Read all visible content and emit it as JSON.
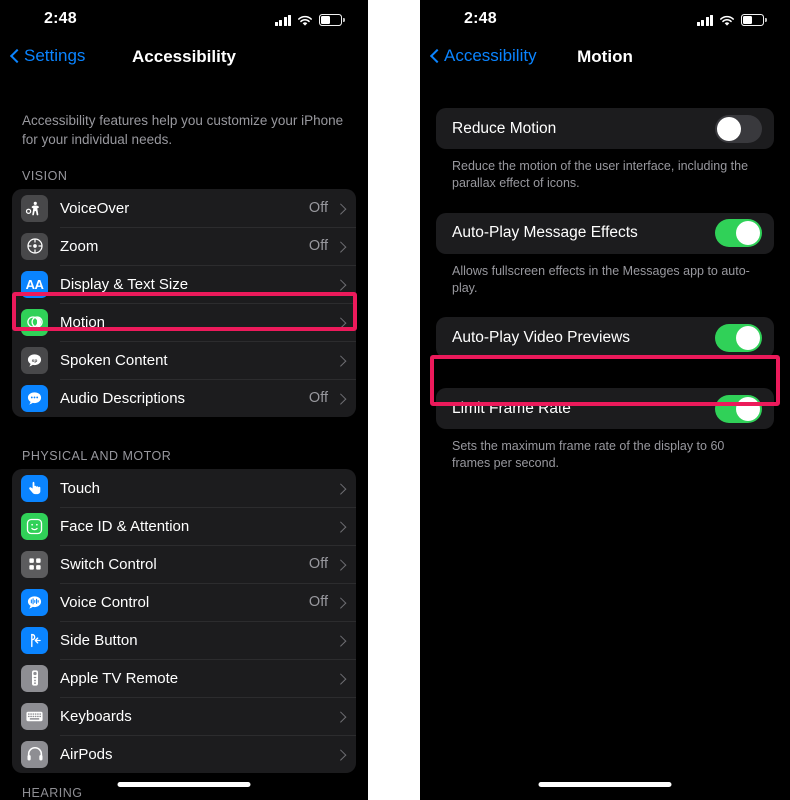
{
  "status_bar": {
    "time": "2:48",
    "signal_icon": "cellular-signal-icon",
    "wifi_icon": "wifi-icon",
    "battery_icon": "battery-icon"
  },
  "colors": {
    "accent_blue": "#0a84ff",
    "toggle_on_green": "#30d158",
    "toggle_off_gray": "#39393d",
    "highlight_pink": "#ec1a5b",
    "group_background": "#1c1c1e",
    "screen_background": "#000000",
    "secondary_text": "#98989e"
  },
  "left_screen": {
    "nav": {
      "back_label": "Settings",
      "title": "Accessibility"
    },
    "intro": "Accessibility features help you customize your iPhone for your individual needs.",
    "sections": [
      {
        "header": "VISION",
        "items": [
          {
            "label": "VoiceOver",
            "value": "Off",
            "icon": "voiceover-icon",
            "icon_color": "#48484a",
            "highlighted": false
          },
          {
            "label": "Zoom",
            "value": "Off",
            "icon": "zoom-icon",
            "icon_color": "#48484a",
            "highlighted": false
          },
          {
            "label": "Display & Text Size",
            "value": "",
            "icon": "display-text-size-icon",
            "icon_color": "#0a84ff",
            "highlighted": false
          },
          {
            "label": "Motion",
            "value": "",
            "icon": "motion-icon",
            "icon_color": "#30d158",
            "highlighted": true
          },
          {
            "label": "Spoken Content",
            "value": "",
            "icon": "spoken-content-icon",
            "icon_color": "#48484a",
            "highlighted": false
          },
          {
            "label": "Audio Descriptions",
            "value": "Off",
            "icon": "audio-descriptions-icon",
            "icon_color": "#0a84ff",
            "highlighted": false
          }
        ]
      },
      {
        "header": "PHYSICAL AND MOTOR",
        "items": [
          {
            "label": "Touch",
            "value": "",
            "icon": "touch-icon",
            "icon_color": "#0a84ff",
            "highlighted": false
          },
          {
            "label": "Face ID & Attention",
            "value": "",
            "icon": "face-id-icon",
            "icon_color": "#30d158",
            "highlighted": false
          },
          {
            "label": "Switch Control",
            "value": "Off",
            "icon": "switch-control-icon",
            "icon_color": "#5c5c5e",
            "highlighted": false
          },
          {
            "label": "Voice Control",
            "value": "Off",
            "icon": "voice-control-icon",
            "icon_color": "#0a84ff",
            "highlighted": false
          },
          {
            "label": "Side Button",
            "value": "",
            "icon": "side-button-icon",
            "icon_color": "#0a84ff",
            "highlighted": false
          },
          {
            "label": "Apple TV Remote",
            "value": "",
            "icon": "apple-tv-remote-icon",
            "icon_color": "#8e8e93",
            "highlighted": false
          },
          {
            "label": "Keyboards",
            "value": "",
            "icon": "keyboards-icon",
            "icon_color": "#8e8e93",
            "highlighted": false
          },
          {
            "label": "AirPods",
            "value": "",
            "icon": "airpods-icon",
            "icon_color": "#8e8e93",
            "highlighted": false
          }
        ]
      }
    ],
    "partial_section_header": "HEARING"
  },
  "right_screen": {
    "nav": {
      "back_label": "Accessibility",
      "title": "Motion"
    },
    "settings": [
      {
        "label": "Reduce Motion",
        "state": "off",
        "footnote": "Reduce the motion of the user interface, including the parallax effect of icons.",
        "highlighted": false
      },
      {
        "label": "Auto-Play Message Effects",
        "state": "on",
        "footnote": "Allows fullscreen effects in the Messages app to auto-play.",
        "highlighted": false
      },
      {
        "label": "Auto-Play Video Previews",
        "state": "on",
        "footnote": "",
        "highlighted": false
      },
      {
        "label": "Limit Frame Rate",
        "state": "on",
        "footnote": "Sets the maximum frame rate of the display to 60 frames per second.",
        "highlighted": true
      }
    ]
  }
}
